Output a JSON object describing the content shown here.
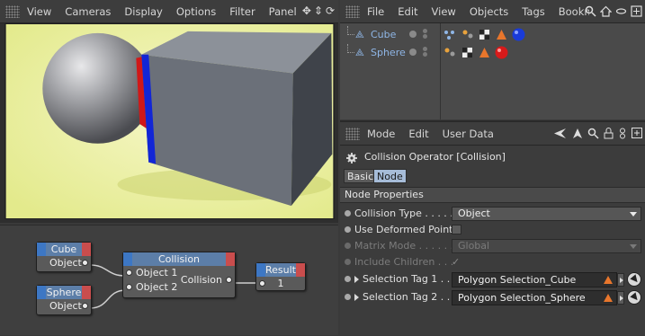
{
  "viewport": {
    "menu": [
      "View",
      "Cameras",
      "Display",
      "Options",
      "Filter",
      "Panel"
    ],
    "nav_icons": [
      "search-icon",
      "move-icon",
      "zoom-icon",
      "rotate-icon"
    ]
  },
  "node_editor": {
    "nodes": {
      "cube": {
        "title": "Cube",
        "port": "Object"
      },
      "sphere": {
        "title": "Sphere",
        "port": "Object"
      },
      "collision": {
        "title": "Collision",
        "inputs": [
          "Object 1",
          "Object 2"
        ],
        "output": "Collision"
      },
      "result": {
        "title": "Result",
        "value": "1"
      }
    }
  },
  "object_manager": {
    "menu": [
      "File",
      "Edit",
      "View",
      "Objects",
      "Tags",
      "Bookm"
    ],
    "objects": [
      {
        "name": "Cube",
        "icon": "cube-object-icon",
        "tags": [
          "xpresso-tag-icon",
          "material-tag-icon",
          "texture-tag-icon",
          "phong-tag-icon",
          "selection-tag-icon",
          "blue-material-icon"
        ]
      },
      {
        "name": "Sphere",
        "icon": "sphere-object-icon",
        "tags": [
          "material-tag-icon",
          "texture-tag-icon",
          "selection-tag-icon",
          "red-material-icon"
        ]
      }
    ]
  },
  "attribute_manager": {
    "menu": [
      "Mode",
      "Edit",
      "User Data"
    ],
    "title": "Collision Operator [Collision]",
    "tabs": {
      "basic": "Basic",
      "node": "Node"
    },
    "section": "Node Properties",
    "props": {
      "collision_type": {
        "label": "Collision Type . . . . . .",
        "value": "Object"
      },
      "use_deformed": {
        "label": "Use Deformed Points"
      },
      "matrix_mode": {
        "label": "Matrix Mode . . . . . . . .",
        "value": "Global"
      },
      "include_children": {
        "label": "Include Children . . .",
        "check": "✓"
      },
      "sel_tag_1": {
        "label": "Selection Tag 1 . . . .",
        "value": "Polygon Selection_Cube"
      },
      "sel_tag_2": {
        "label": "Selection Tag 2 . . . .",
        "value": "Polygon Selection_Sphere"
      }
    }
  },
  "colors": {
    "accent_blue": "#5c7ea8",
    "port_blue": "#3d77c4",
    "port_red": "#c94d4d",
    "scene_bg": "#e8ef9c",
    "warn_orange": "#e8762c"
  }
}
